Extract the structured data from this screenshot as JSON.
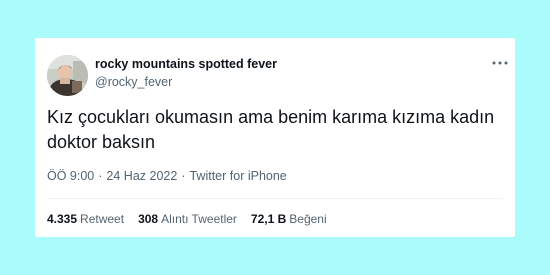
{
  "tweet": {
    "display_name": "rocky mountains spotted fever",
    "handle": "@rocky_fever",
    "more_icon": "ellipsis-icon",
    "text": "Kız çocukları okumasın ama benim karıma kızıma kadın doktor baksın",
    "time": "ÖÖ 9:00",
    "separator1": "·",
    "date": "24 Haz 2022",
    "separator2": "·",
    "source": "Twitter for iPhone"
  },
  "stats": {
    "retweets": {
      "count": "4.335",
      "label": "Retweet"
    },
    "quotes": {
      "count": "308",
      "label": "Alıntı Tweetler"
    },
    "likes": {
      "count": "72,1 B",
      "label": "Beğeni"
    }
  },
  "colors": {
    "background": "#aafcfa",
    "card": "#ffffff",
    "primary_text": "#0f1419",
    "secondary_text": "#536471"
  }
}
